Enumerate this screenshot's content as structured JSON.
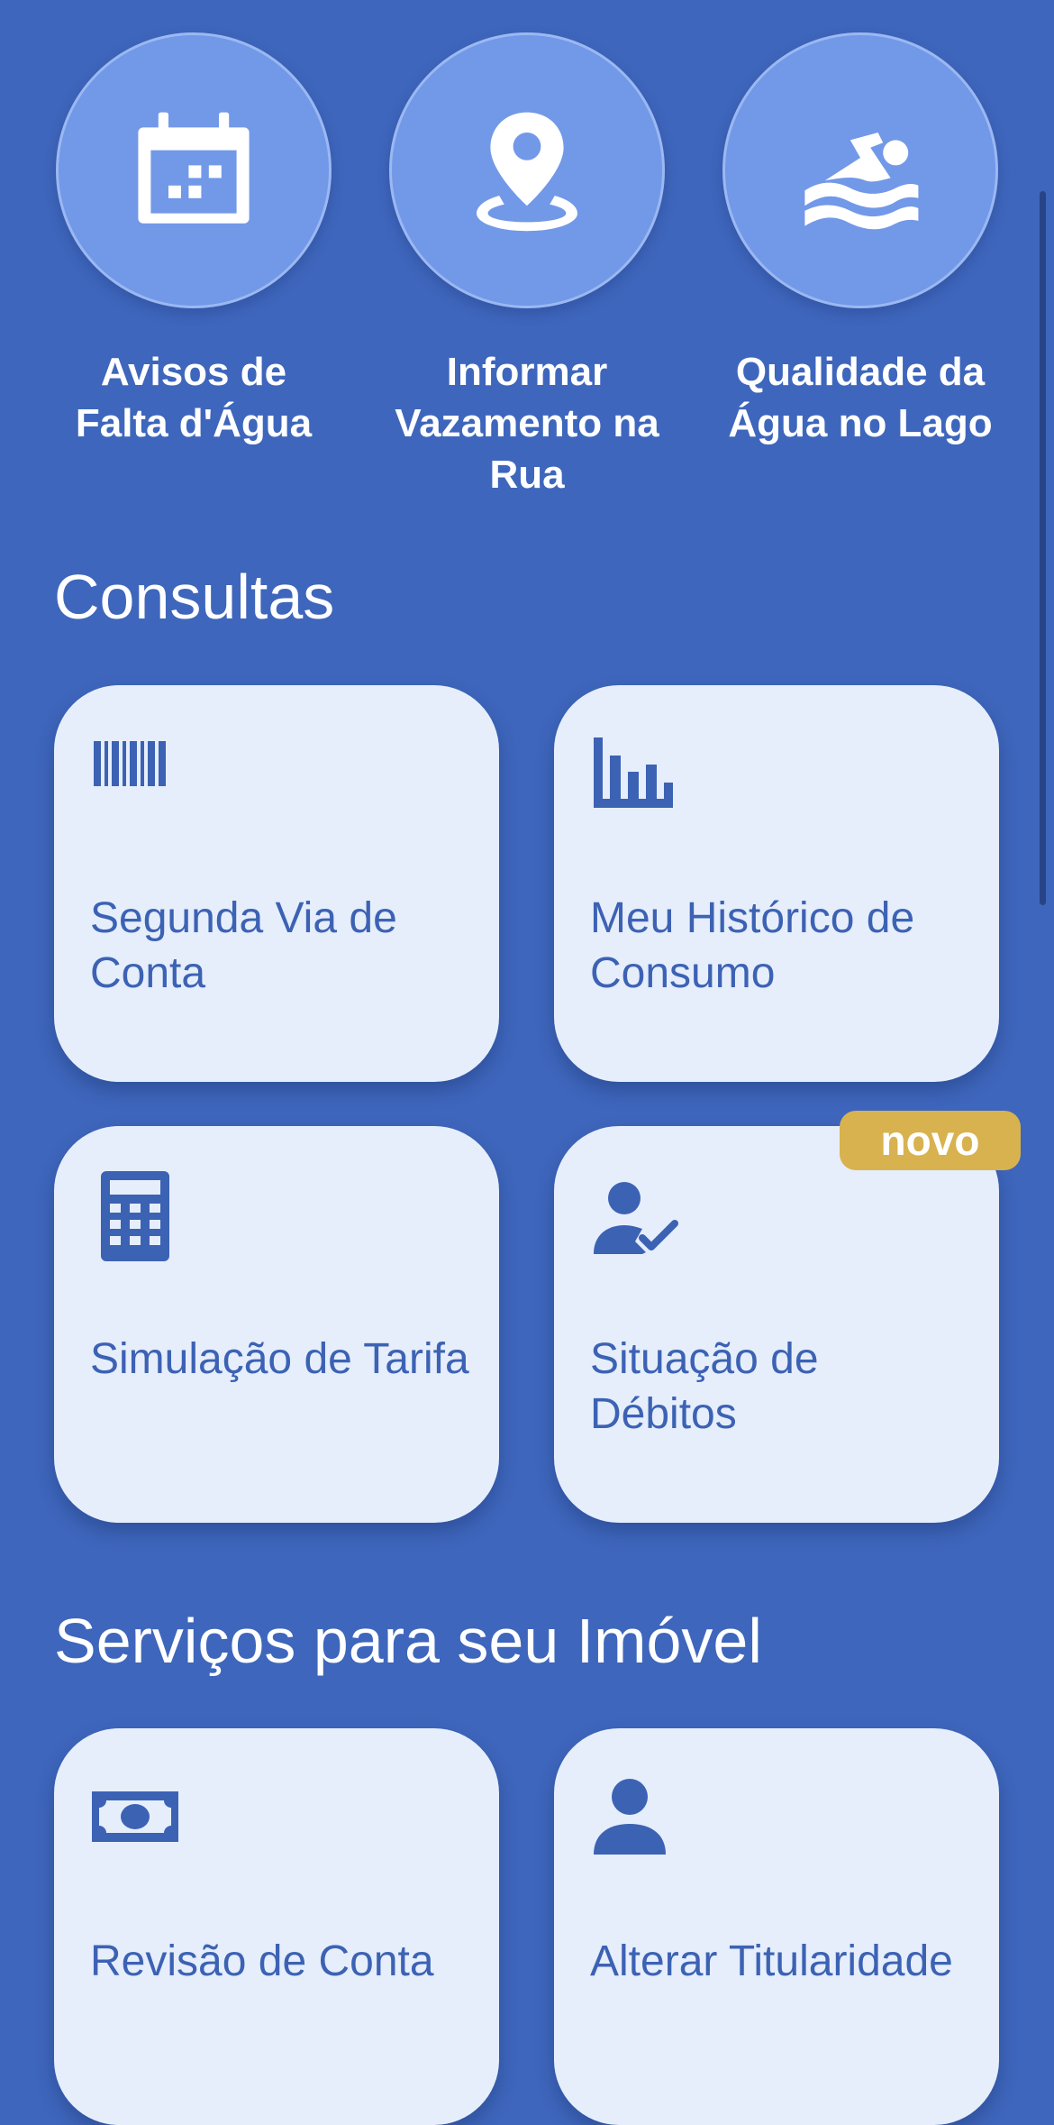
{
  "quick_actions": [
    {
      "label": "Avisos de Falta d'Água",
      "icon": "calendar-icon"
    },
    {
      "label": "Informar Vazamento na Rua",
      "icon": "location-pin-icon"
    },
    {
      "label": "Qualidade da Água no Lago",
      "icon": "swimmer-icon"
    }
  ],
  "sections": {
    "consultas": {
      "title": "Consultas",
      "cards": [
        {
          "label": "Segunda Via de Conta",
          "icon": "barcode-icon"
        },
        {
          "label": "Meu Histórico de Consumo",
          "icon": "bar-chart-icon"
        },
        {
          "label": "Simulação de Tarifa",
          "icon": "calculator-icon"
        },
        {
          "label": "Situação de Débitos",
          "icon": "user-check-icon",
          "badge": "novo"
        }
      ]
    },
    "servicos": {
      "title": "Serviços para seu Imóvel",
      "cards": [
        {
          "label": "Revisão de Conta",
          "icon": "money-bill-icon"
        },
        {
          "label": "Alterar Titularidade",
          "icon": "person-icon"
        }
      ]
    }
  },
  "colors": {
    "background": "#3E66BC",
    "circle": "#7298E8",
    "card": "#E6EEFB",
    "card_text": "#3C62B4",
    "badge": "#D8B24E"
  }
}
